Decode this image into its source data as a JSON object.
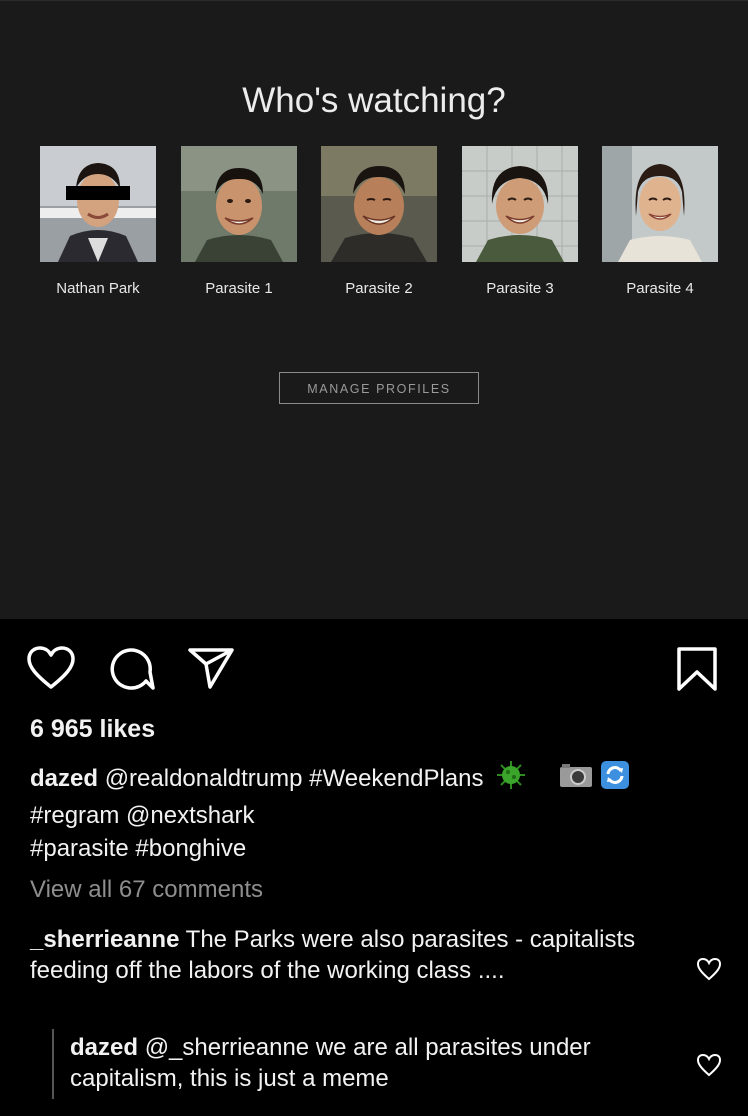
{
  "screen": {
    "title": "Who's watching?",
    "profiles": [
      {
        "name": "Nathan Park"
      },
      {
        "name": "Parasite 1"
      },
      {
        "name": "Parasite 2"
      },
      {
        "name": "Parasite 3"
      },
      {
        "name": "Parasite 4"
      }
    ],
    "manage_label": "MANAGE PROFILES"
  },
  "post": {
    "likes": "6 965 likes",
    "caption": {
      "username": "dazed",
      "line1": "@realdonaldtrump #WeekendPlans",
      "line2": "#regram @nextshark",
      "line3": "#parasite #bonghive"
    },
    "view_comments": "View all 67 comments",
    "comments": [
      {
        "username": "_sherrieanne",
        "text": "The Parks were also parasites - capitalists feeding off the labors of the working class ...."
      },
      {
        "username": "dazed",
        "text": "@_sherrieanne we are all parasites under capitalism, this is just a meme"
      }
    ]
  },
  "icons": [
    "heart-icon",
    "comment-icon",
    "share-icon",
    "bookmark-icon",
    "virus-icon",
    "camera-icon",
    "repeat-icon"
  ],
  "colors": {
    "panel_bg": "#1b1a1b",
    "page_bg": "#000000",
    "muted": "#8e8e8e",
    "virus_green": "#2e8b20"
  }
}
